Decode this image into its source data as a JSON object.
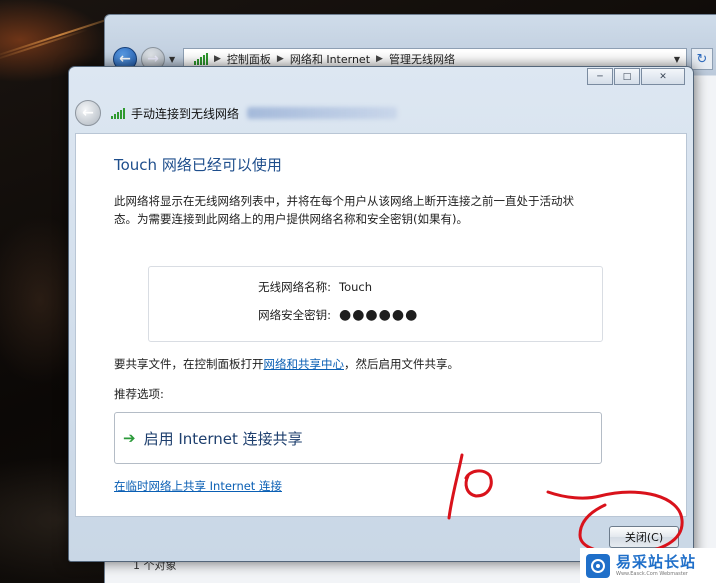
{
  "explorer": {
    "breadcrumb": [
      "控制面板",
      "网络和 Internet",
      "管理无线网络"
    ],
    "status_text": "1 个对象"
  },
  "dialog": {
    "title": "手动连接到无线网络",
    "headline": "Touch 网络已经可以使用",
    "description": "此网络将显示在无线网络列表中，并将在每个用户从该网络上断开连接之前一直处于活动状态。为需要连接到此网络上的用户提供网络名称和安全密钥(如果有)。",
    "network_name_label": "无线网络名称:",
    "network_name_value": "Touch",
    "security_key_label": "网络安全密钥:",
    "security_key_value": "●●●●●●",
    "share_prefix": "要共享文件，在控制面板打开",
    "share_link": "网络和共享中心",
    "share_suffix": "，然后启用文件共享。",
    "recommended_label": "推荐选项:",
    "command_label": "启用 Internet 连接共享",
    "bottom_link": "在临时网络上共享 Internet 连接",
    "close_button": "关闭(C)"
  },
  "annotation": {
    "handwritten_text": "10"
  },
  "watermark": {
    "name": "易采站长站",
    "url": "Www.Easck.Com Webmaster"
  },
  "colors": {
    "headline": "#1e4e8c",
    "link": "#0a5fb4",
    "command_arrow": "#2b9a3a",
    "annotation_red": "#d9121b"
  },
  "icons": {
    "nav_back": "back-arrow-icon",
    "nav_forward": "forward-arrow-icon",
    "signal": "wireless-signal-icon",
    "refresh": "refresh-icon",
    "command": "green-arrow-icon"
  }
}
